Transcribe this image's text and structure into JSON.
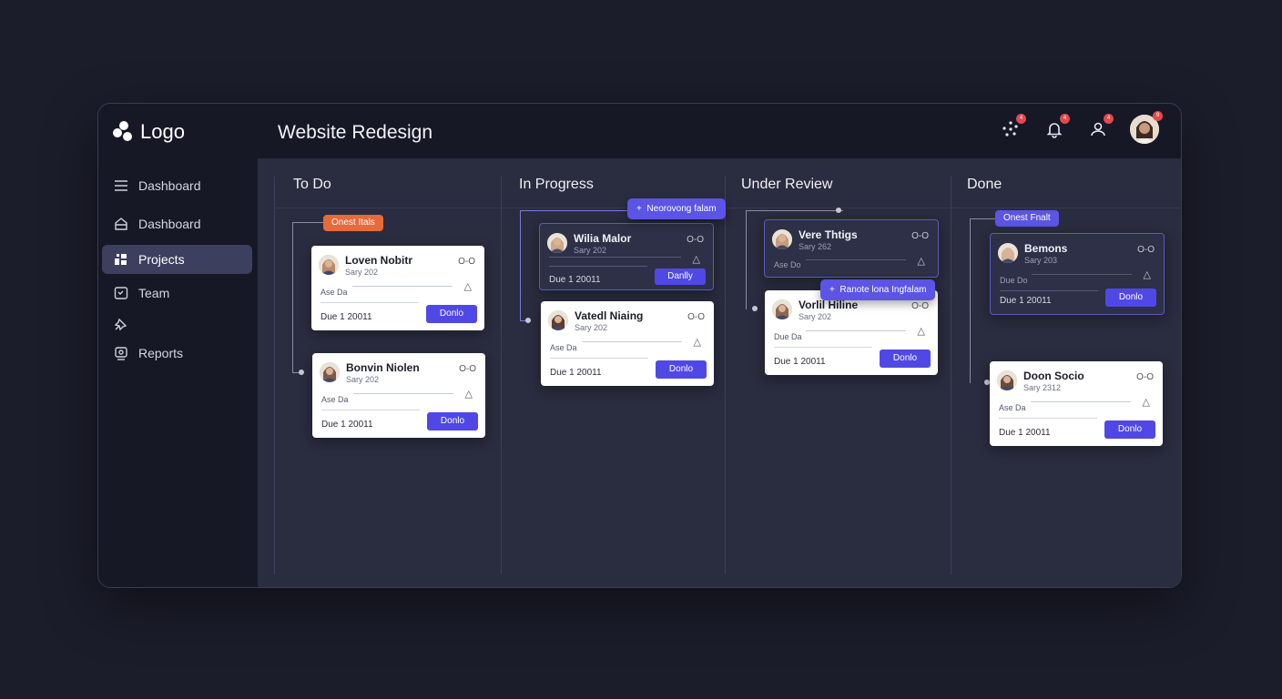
{
  "app": {
    "logo_text": "Logo",
    "title": "Website Redesign"
  },
  "header": {
    "icons": [
      {
        "name": "activity-icon",
        "badge": "4"
      },
      {
        "name": "bell-icon",
        "badge": "4"
      },
      {
        "name": "user-icon",
        "badge": "4"
      }
    ],
    "avatar_badge": "9"
  },
  "sidebar": {
    "items": [
      {
        "label": "Dashboard",
        "icon": "menu-icon"
      },
      {
        "label": "Dashboard",
        "icon": "home-icon"
      },
      {
        "label": "Projects",
        "icon": "grid-icon",
        "active": true
      },
      {
        "label": "Team",
        "icon": "chat-icon"
      },
      {
        "label": "",
        "icon": "pin-icon"
      },
      {
        "label": "Reports",
        "icon": "report-icon"
      }
    ]
  },
  "board": {
    "columns": [
      {
        "title": "To Do",
        "tag": "Onest Itals"
      },
      {
        "title": "In Progress",
        "float_tag": "Neorovong falam"
      },
      {
        "title": "Under Review",
        "float_tag": "Ranote lona Ingfalam"
      },
      {
        "title": "Done",
        "tag": "Onest Fnalt"
      }
    ],
    "cards": {
      "todo_1": {
        "name": "Loven Nobitr",
        "sub": "Sary 202",
        "label": "Ase Da",
        "due": "Due 1 20011",
        "button": "Donlo",
        "link": "O-O"
      },
      "todo_2": {
        "name": "Bonvin Niolen",
        "sub": "Sary 202",
        "label": "Ase Da",
        "due": "Due 1 20011",
        "button": "Donlo",
        "link": "O-O"
      },
      "prog_1": {
        "name": "Wilia Malor",
        "sub": "Sary 202",
        "label": "",
        "due": "Due 1 20011",
        "button": "Danlly",
        "link": "O-O"
      },
      "prog_2": {
        "name": "Vatedl Niaing",
        "sub": "Sary 202",
        "label": "Ase Da",
        "due": "Due 1 20011",
        "button": "Donlo",
        "link": "O-O"
      },
      "rev_1": {
        "name": "Vere Thtigs",
        "sub": "Sary 262",
        "label": "Ase Do",
        "due": "",
        "button": "",
        "link": "O-O"
      },
      "rev_2": {
        "name": "Vorlil Hiline",
        "sub": "Sary 202",
        "label": "Due Da",
        "due": "Due 1 20011",
        "button": "Donlo",
        "link": "O-O"
      },
      "done_1": {
        "name": "Bemons",
        "sub": "Sary 203",
        "label": "Due Do",
        "due": "Due 1 20011",
        "button": "Donlo",
        "link": "O-O"
      },
      "done_2": {
        "name": "Doon Socio",
        "sub": "Sary 2312",
        "label": "Ase Da",
        "due": "Due 1 20011",
        "button": "Donlo",
        "link": "O-O"
      }
    }
  }
}
